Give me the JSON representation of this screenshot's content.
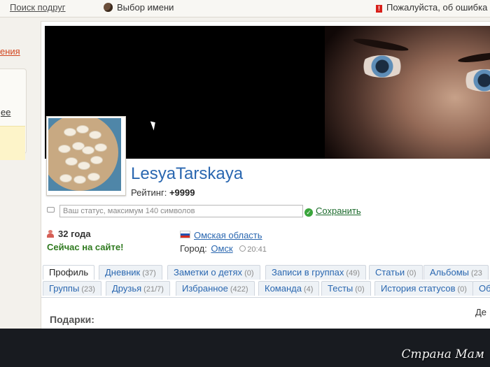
{
  "topbar": {
    "find_friends": "Поиск подруг",
    "choose_name": "Выбор имени",
    "report_error": "Пожалуйста, об ошибка"
  },
  "left": {
    "red_link": "ения",
    "more_link": "ее"
  },
  "profile": {
    "username": "LesyaTarskaya",
    "rating_label": "Рейтинг:",
    "rating_value": "+9999",
    "status_placeholder": "Ваш статус, максимум 140 символов",
    "save_label": "Сохранить",
    "age": "32 года",
    "online": "Сейчас на сайте!",
    "region": "Омская область",
    "city_label": "Город:",
    "city": "Омск",
    "local_time": "20:41"
  },
  "tabs_row1": [
    {
      "label": "Профиль",
      "count": ""
    },
    {
      "label": "Дневник",
      "count": "(37)"
    },
    {
      "label": "Заметки о детях",
      "count": "(0)"
    },
    {
      "label": "Записи в группах",
      "count": "(49)"
    },
    {
      "label": "Статьи",
      "count": "(0)"
    },
    {
      "label": "Альбомы",
      "count": "(23"
    }
  ],
  "tabs_row2": [
    {
      "label": "Группы",
      "count": "(23)"
    },
    {
      "label": "Друзья",
      "count": "(21/7)"
    },
    {
      "label": "Избранное",
      "count": "(422)"
    },
    {
      "label": "Команда",
      "count": "(4)"
    },
    {
      "label": "Тесты",
      "count": "(0)"
    },
    {
      "label": "История статусов",
      "count": "(0)"
    },
    {
      "label": "Об",
      "count": ""
    }
  ],
  "content": {
    "gifts_heading": "Подарки:",
    "right_cut": "Де"
  },
  "watermark": "Страна Мам"
}
